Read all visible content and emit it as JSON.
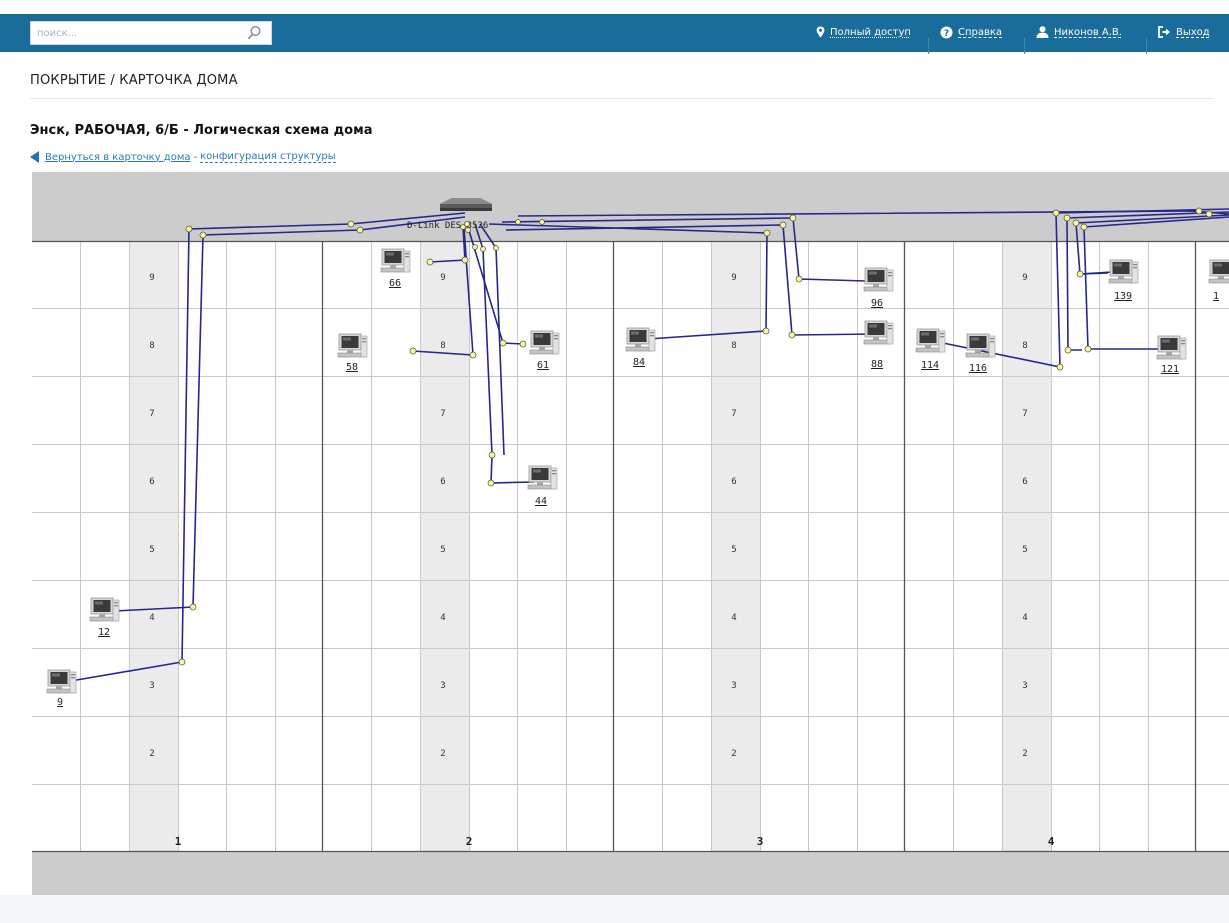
{
  "header": {
    "search_placeholder": "поиск...",
    "nav": {
      "access": "Полный доступ",
      "help": "Справка",
      "user": "Никонов А.В.",
      "exit": "Выход"
    },
    "icons": {
      "search": "search-icon",
      "access": "map-pin-icon",
      "help": "help-circle-icon",
      "user": "user-icon",
      "exit": "logout-icon"
    }
  },
  "breadcrumb": "ПОКРЫТИЕ / КАРТОЧКА ДОМА",
  "page_title": "Энск, РАБОЧАЯ, 6/Б - Логическая схема дома",
  "links": {
    "back": "Вернуться в карточку дома",
    "separator": "-",
    "config": "конфигурация структуры"
  },
  "schema": {
    "switch_label": "D-Link DES-3526",
    "entrances": [
      "1",
      "2",
      "3",
      "4"
    ],
    "floors": [
      "9",
      "8",
      "7",
      "6",
      "5",
      "4",
      "3",
      "2"
    ],
    "devices": [
      {
        "id": "9",
        "entrance": "1",
        "floor": "3"
      },
      {
        "id": "12",
        "entrance": "1",
        "floor": "4"
      },
      {
        "id": "66",
        "entrance": "2",
        "floor": "9"
      },
      {
        "id": "58",
        "entrance": "2",
        "floor": "8"
      },
      {
        "id": "61",
        "entrance": "2",
        "floor": "8"
      },
      {
        "id": "44",
        "entrance": "2",
        "floor": "6"
      },
      {
        "id": "84",
        "entrance": "3",
        "floor": "8"
      },
      {
        "id": "96",
        "entrance": "3",
        "floor": "9"
      },
      {
        "id": "88",
        "entrance": "3",
        "floor": "8"
      },
      {
        "id": "114",
        "entrance": "4",
        "floor": "8"
      },
      {
        "id": "116",
        "entrance": "4",
        "floor": "8"
      },
      {
        "id": "139",
        "entrance": "4",
        "floor": "9"
      },
      {
        "id": "121",
        "entrance": "4",
        "floor": "8"
      },
      {
        "id": "1",
        "entrance": "5",
        "floor": "9"
      }
    ],
    "colors": {
      "cable": "#25278c",
      "joint": "#f6f4b0",
      "stairwell": "#ebebeb",
      "band": "#cccccc",
      "grid": "#c9c9c9",
      "divider": "#555555"
    }
  }
}
